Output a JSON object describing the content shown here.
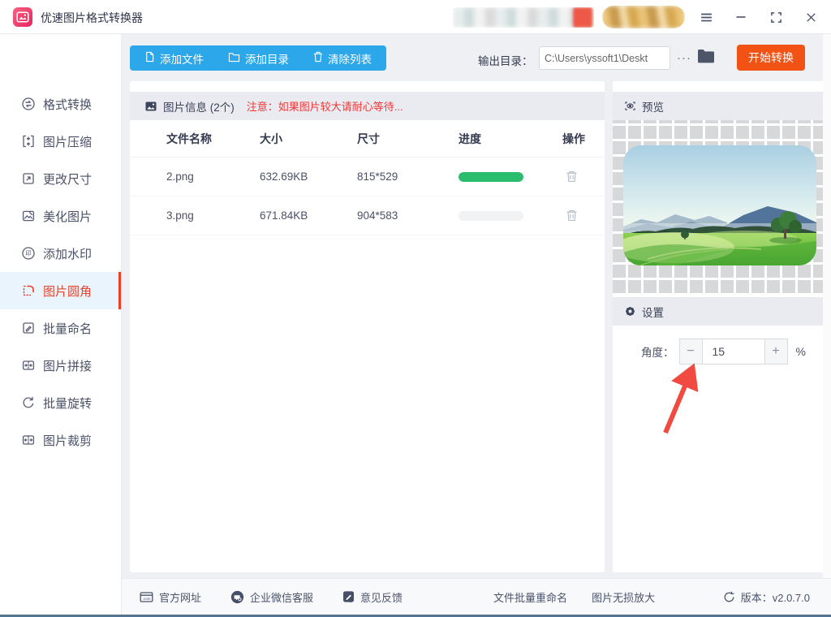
{
  "titlebar": {
    "app_title": "优速图片格式转换器"
  },
  "toolbar": {
    "add_file": "添加文件",
    "add_dir": "添加目录",
    "clear_list": "清除列表",
    "output_label": "输出目录：",
    "output_path": "C:\\Users\\yssoft1\\Deskt",
    "more_label": "···",
    "start_label": "开始转换"
  },
  "sidebar": {
    "items": [
      {
        "label": "格式转换",
        "icon": "format-convert",
        "active": false
      },
      {
        "label": "图片压缩",
        "icon": "compress",
        "active": false
      },
      {
        "label": "更改尺寸",
        "icon": "resize",
        "active": false
      },
      {
        "label": "美化图片",
        "icon": "beautify",
        "active": false
      },
      {
        "label": "添加水印",
        "icon": "watermark",
        "active": false
      },
      {
        "label": "图片圆角",
        "icon": "round-corner",
        "active": true
      },
      {
        "label": "批量命名",
        "icon": "rename",
        "active": false
      },
      {
        "label": "图片拼接",
        "icon": "stitch",
        "active": false
      },
      {
        "label": "批量旋转",
        "icon": "rotate",
        "active": false
      },
      {
        "label": "图片裁剪",
        "icon": "crop",
        "active": false
      }
    ]
  },
  "filelist": {
    "info_title": "图片信息 (2个)",
    "info_warning": "注意：如果图片较大请耐心等待...",
    "columns": [
      "文件名称",
      "大小",
      "尺寸",
      "进度",
      "操作"
    ],
    "rows": [
      {
        "name": "2.png",
        "size": "632.69KB",
        "dim": "815*529",
        "progress": 100
      },
      {
        "name": "3.png",
        "size": "671.84KB",
        "dim": "904*583",
        "progress": 0
      }
    ]
  },
  "preview": {
    "title": "预览"
  },
  "settings": {
    "title": "设置",
    "angle_label": "角度：",
    "minus_label": "−",
    "value": "15",
    "plus_label": "+",
    "unit": "%"
  },
  "footer": {
    "links": [
      {
        "label": "官方网址",
        "icon": "website"
      },
      {
        "label": "企业微信客服",
        "icon": "wechat-service"
      },
      {
        "label": "意见反馈",
        "icon": "feedback"
      }
    ],
    "extras": [
      "文件批量重命名",
      "图片无损放大"
    ],
    "version_label": "版本：v2.0.7.0"
  },
  "colors": {
    "accent_blue": "#2ba7ea",
    "accent_orange": "#f25214",
    "active_red": "#e8432a",
    "warning_red": "#f23636",
    "progress_green": "#2abd6e"
  }
}
